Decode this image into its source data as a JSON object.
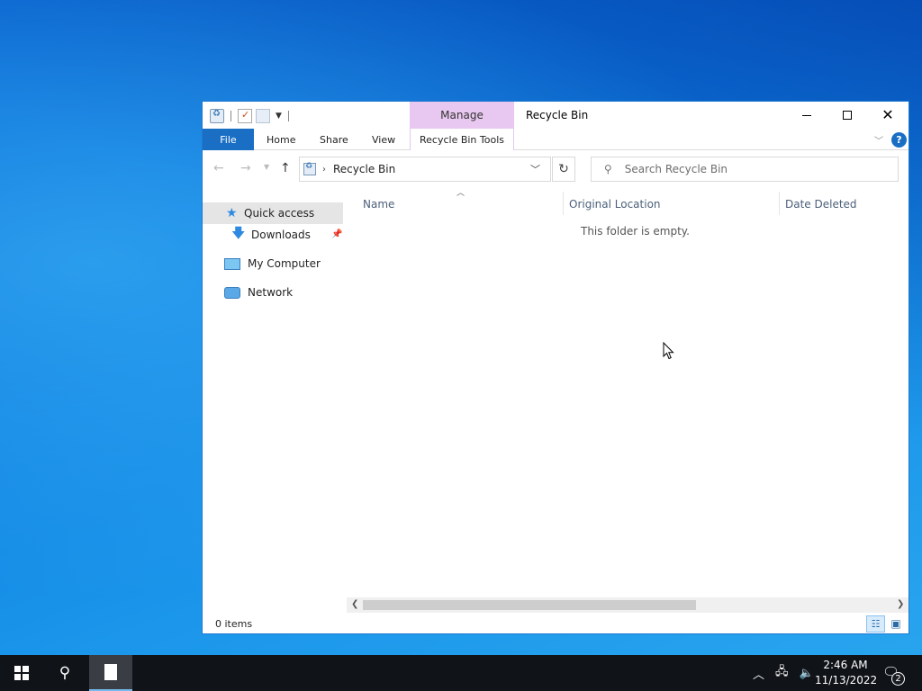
{
  "window": {
    "title": "Recycle Bin",
    "contextual_tab_group": "Manage"
  },
  "ribbon": {
    "tabs": [
      {
        "label": "File"
      },
      {
        "label": "Home"
      },
      {
        "label": "Share"
      },
      {
        "label": "View"
      },
      {
        "label": "Recycle Bin Tools"
      }
    ],
    "help_label": "?"
  },
  "address": {
    "path_label": "Recycle Bin",
    "icon": "recycle-bin-icon"
  },
  "search": {
    "placeholder": "Search Recycle Bin"
  },
  "nav_pane": {
    "items": [
      {
        "label": "Quick access",
        "icon": "star-icon",
        "selected": true
      },
      {
        "label": "Downloads",
        "icon": "download-arrow-icon",
        "pinned": true
      },
      {
        "label": "My Computer",
        "icon": "computer-icon"
      },
      {
        "label": "Network",
        "icon": "network-icon"
      }
    ]
  },
  "columns": [
    {
      "label": "Name"
    },
    {
      "label": "Original Location"
    },
    {
      "label": "Date Deleted"
    }
  ],
  "content": {
    "empty_message": "This folder is empty."
  },
  "status": {
    "item_count": "0 items"
  },
  "taskbar": {
    "time": "2:46 AM",
    "date": "11/13/2022",
    "notification_count": "2"
  },
  "colors": {
    "accent": "#1a6fc4",
    "manage_tab": "#e8c8f0",
    "taskbar": "#101318"
  }
}
